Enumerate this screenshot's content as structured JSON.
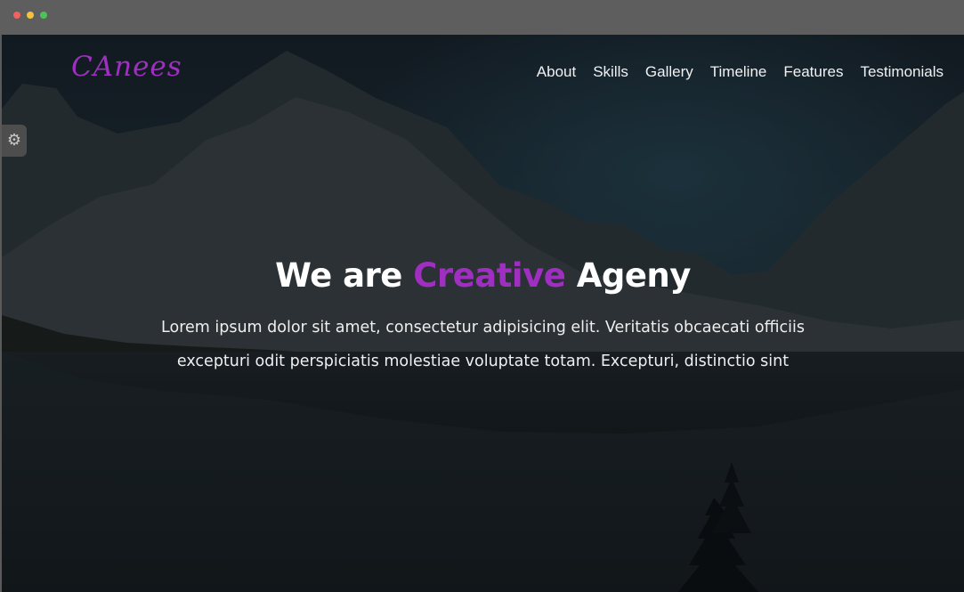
{
  "browser": {
    "controls": [
      "close",
      "minimize",
      "maximize"
    ]
  },
  "header": {
    "logo_text": "CAnees",
    "nav": [
      "About",
      "Skills",
      "Gallery",
      "Timeline",
      "Features",
      "Testimonials"
    ]
  },
  "settings": {
    "icon": "gear-icon"
  },
  "hero": {
    "title_prefix": "We are ",
    "title_accent": "Creative",
    "title_suffix": " Ageny",
    "text": "Lorem ipsum dolor sit amet, consectetur adipisicing elit. Veritatis obcaecati officiis excepturi odit perspiciatis molestiae voluptate totam. Excepturi, distinctio sint"
  },
  "colors": {
    "accent": "#9f2fc1",
    "overlay": "#0f1820",
    "chrome": "#5e5e5e"
  }
}
